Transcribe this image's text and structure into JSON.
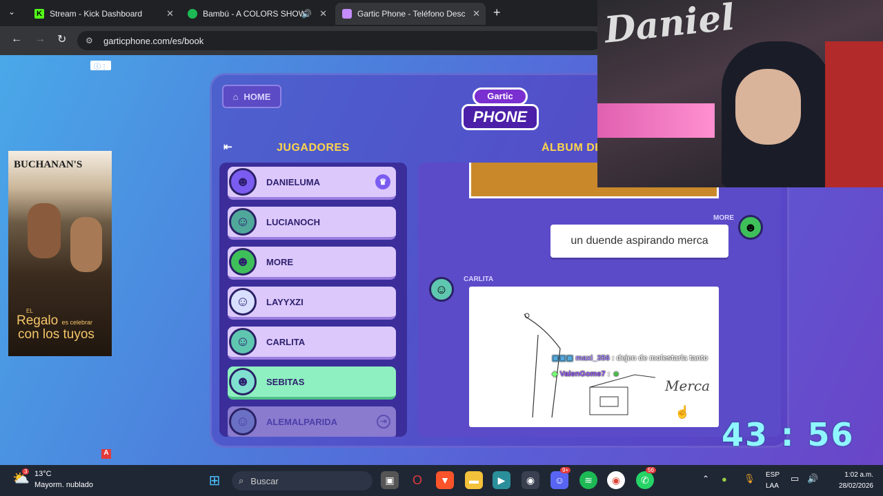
{
  "browser": {
    "tabs": [
      {
        "title": "Stream - Kick Dashboard",
        "icon": "kick-icon",
        "color": "#53fc18"
      },
      {
        "title": "Bambú - A COLORS SHOW",
        "icon": "spotify-icon",
        "color": "#1db954"
      },
      {
        "title": "Gartic Phone - Teléfono Descon",
        "icon": "gartic-icon",
        "color": "#c58cff"
      }
    ],
    "url": "garticphone.com/es/book"
  },
  "game": {
    "home_label": "HOME",
    "logo_top": "Gartic",
    "logo_bottom": "PHONE",
    "players_title": "JUGADORES",
    "album_title": "ÁLBUM DE",
    "players": [
      {
        "name": "DANIELUMA",
        "avatar_color": "#7b5cf0",
        "face": "☻"
      },
      {
        "name": "LUCIANOCH",
        "avatar_color": "#4fa89a",
        "face": "☺"
      },
      {
        "name": "MORE",
        "avatar_color": "#3fbf5a",
        "face": "☻"
      },
      {
        "name": "LAYYXZI",
        "avatar_color": "#d9e0ff",
        "face": "☺"
      },
      {
        "name": "CARLITA",
        "avatar_color": "#5fc6b0",
        "face": "☺"
      },
      {
        "name": "SEBITAS",
        "avatar_color": "#7fe0d0",
        "face": "☻"
      },
      {
        "name": "ALEMALPARIDA",
        "avatar_color": "#6a70c4",
        "face": "☺"
      }
    ],
    "album": {
      "more_name": "MORE",
      "more_text": "un duende aspirando merca",
      "carlita_name": "CARLITA",
      "drawing_word": "Merca"
    }
  },
  "ad": {
    "brand": "BUCHANAN'S",
    "tagline_small": "EL",
    "tagline_big1": "Regalo",
    "tagline_mid": "es celebrar",
    "tagline_big2": "con los tuyos"
  },
  "overlay": {
    "chat": [
      {
        "user": "maxi_356",
        "text": ": dejen de molestarla tanto",
        "color": "#a98bff"
      },
      {
        "user": "ValenGome7",
        "text": ":",
        "color": "#9b5cff"
      }
    ],
    "timer": "43 : 56",
    "webcam_wall_text": "Daniel"
  },
  "taskbar": {
    "weather_temp": "13°C",
    "weather_desc": "Mayorm. nublado",
    "search_placeholder": "Buscar",
    "lang_top": "ESP",
    "lang_bottom": "LAA",
    "time": "1:02 a.m.",
    "date": "28/02/2026",
    "discord_badge": "9+",
    "whatsapp_badge": "56",
    "weather_badge": "3"
  }
}
